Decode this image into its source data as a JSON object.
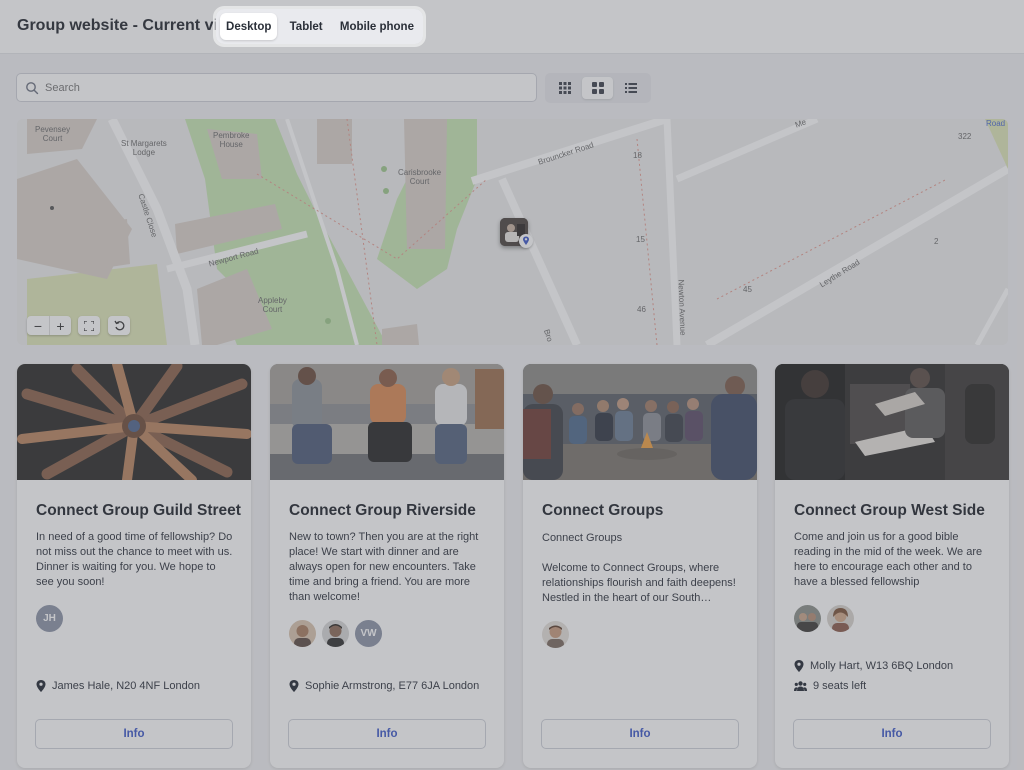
{
  "header": {
    "title": "Group website - Current view",
    "view_options": [
      "Desktop",
      "Tablet",
      "Mobile phone"
    ],
    "active_view": "Desktop"
  },
  "toolbar": {
    "search_placeholder": "Search",
    "layouts": [
      "grid-small-icon",
      "grid-large-icon",
      "list-icon"
    ],
    "active_layout": "grid-large-icon"
  },
  "map": {
    "labels": {
      "pevensey": "Pevensey\nCourt",
      "st_margarets": "St Margarets\nLodge",
      "pembroke": "Pembroke\nHouse",
      "carisbrooke": "Carisbrooke\nCourt",
      "castle_close": "Castle Close",
      "newport_road": "Newport Road",
      "appleby": "Appleby\nCourt",
      "brouncker_road": "Brouncker Road",
      "newton_avenue": "Newton Avenue",
      "leythe_road": "Leythe Road",
      "bro": "Bro",
      "me": "Me",
      "road": "Road",
      "n322": "322",
      "n18": "18",
      "n15": "15",
      "n46": "46",
      "n45": "45",
      "n2": "2"
    },
    "controls": {
      "zoom_out": "−",
      "zoom_in": "+"
    }
  },
  "cards": [
    {
      "title": "Connect Group Guild Street",
      "subtitle": "",
      "description": "In need of a good time of fellowship? Do not miss out the chance to meet with us. Dinner is waiting for you. We hope to see you soon!",
      "avatars": [
        {
          "type": "initials",
          "text": "JH"
        }
      ],
      "location": "James Hale, N20 4NF London",
      "seats": "",
      "button": "Info"
    },
    {
      "title": "Connect Group Riverside",
      "subtitle": "",
      "description": "New to town? Then you are at the right place! We start with dinner and are always open for new encounters. Take time and bring a friend. You are more than welcome!",
      "avatars": [
        {
          "type": "photo"
        },
        {
          "type": "photo"
        },
        {
          "type": "initials",
          "text": "VW"
        }
      ],
      "location": "Sophie Armstrong, E77 6JA London",
      "seats": "",
      "button": "Info"
    },
    {
      "title": "Connect Groups",
      "subtitle": "Connect Groups",
      "description": "Welcome to Connect Groups, where relationships flourish and faith deepens! Nestled in the heart of our South…",
      "avatars": [
        {
          "type": "photo"
        }
      ],
      "location": "",
      "seats": "",
      "button": "Info"
    },
    {
      "title": "Connect Group West Side",
      "subtitle": "",
      "description": "Come and join us for a good bible reading in the mid of the week. We are here to encourage each other and to have a blessed fellowship",
      "avatars": [
        {
          "type": "photo"
        },
        {
          "type": "photo"
        }
      ],
      "location": "Molly Hart, W13 6BQ London",
      "seats": "9 seats left",
      "button": "Info"
    }
  ],
  "colors": {
    "accent": "#3a56c9",
    "map_green": "#c7e6b3",
    "map_building": "#d9d0c9",
    "overlay": "#5c5e66"
  }
}
